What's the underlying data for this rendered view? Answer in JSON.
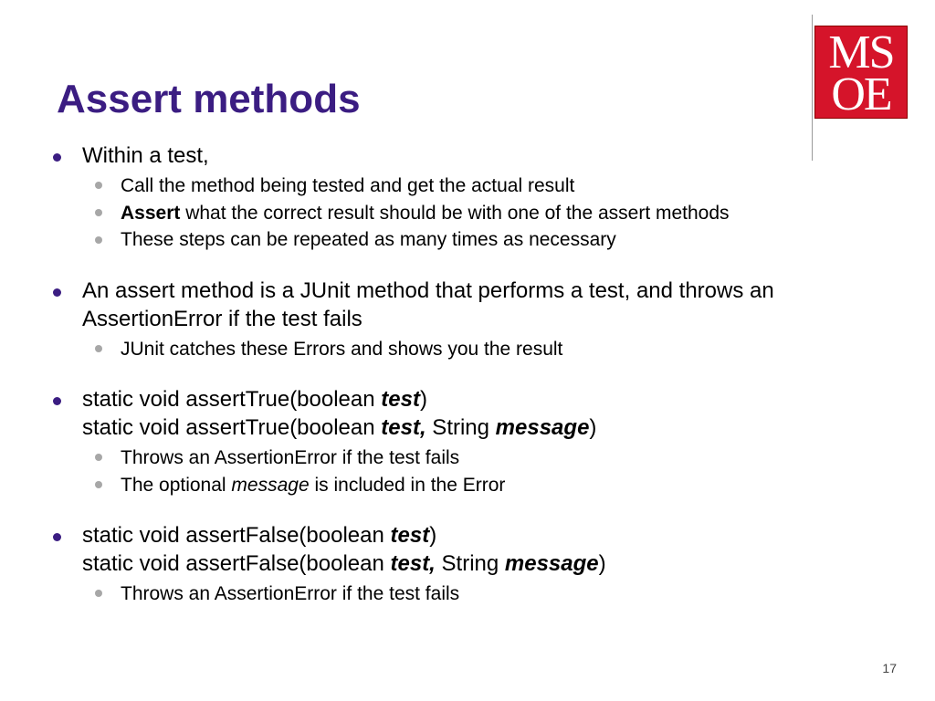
{
  "logo": {
    "line1": "MS",
    "line2": "OE"
  },
  "title": "Assert methods",
  "bullets": {
    "b1": {
      "text": "Within a test,",
      "sub": [
        "Call the method being tested and get the actual result",
        {
          "bold": "Assert",
          "rest": " what the correct result should be with one of the assert methods"
        },
        "These steps can be repeated as many times as necessary"
      ]
    },
    "b2": {
      "text_a": "An assert method is a JUnit method that performs a test, and throws an ",
      "text_b": "AssertionError",
      "text_c": " if the test fails",
      "sub": [
        "JUnit catches these Errors and shows you the result"
      ]
    },
    "b3": {
      "line1": {
        "pre": "static void assertTrue(boolean ",
        "em": "test",
        "post": ")"
      },
      "line2": {
        "pre": "static void assertTrue(boolean ",
        "em1": "test,",
        "mid": " String ",
        "em2": "message",
        "post": ")"
      },
      "sub1": {
        "pre": "Throws an ",
        "ae": "AssertionError",
        "post": " if the test fails"
      },
      "sub2": {
        "pre": "The optional ",
        "em": "message",
        "post": " is included in the Error"
      }
    },
    "b4": {
      "line1": {
        "pre": "static void assertFalse(boolean ",
        "em": "test",
        "post": ")"
      },
      "line2": {
        "pre": "static void assertFalse(boolean ",
        "em1": "test,",
        "mid": " String ",
        "em2": "message",
        "post": ")"
      },
      "sub1": {
        "pre": "Throws an ",
        "ae": "AssertionError",
        "post": " if the test fails"
      }
    }
  },
  "slide_number": "17"
}
